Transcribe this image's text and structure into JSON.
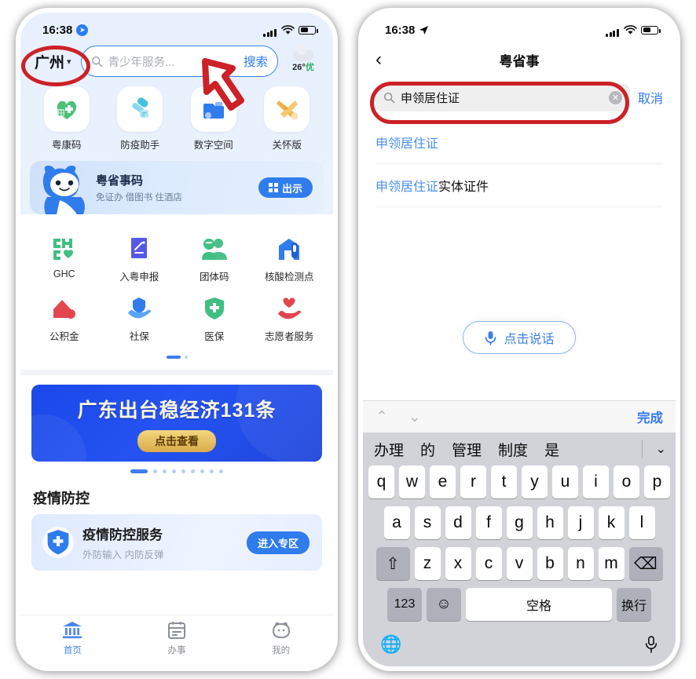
{
  "colors": {
    "accent_blue": "#2f7ced",
    "link_blue": "#4a90f0",
    "highlight_red": "#cc2127",
    "banner_blue": "#1f46dc",
    "gold": "#d9ab4a"
  },
  "left_phone": {
    "status_bar": {
      "time": "16:38",
      "location_icon": "location-arrow-icon",
      "signal_icon": "cellular-signal-icon",
      "wifi_icon": "wifi-icon",
      "battery_icon": "battery-icon"
    },
    "header": {
      "city": "广州",
      "city_chevron": "chevron-down-icon",
      "search_icon": "search-icon",
      "search_placeholder": "青少年服务...",
      "search_button": "搜索",
      "weather_icon": "cloud-icon",
      "weather_temp": "26°",
      "weather_quality": "优"
    },
    "app_row": [
      {
        "label": "粤康码",
        "icon": "heart-health-code-icon"
      },
      {
        "label": "防疫助手",
        "icon": "epidemic-assistant-icon"
      },
      {
        "label": "数字空间",
        "icon": "digital-space-folder-icon"
      },
      {
        "label": "关怀版",
        "icon": "care-version-ribbon-icon"
      }
    ],
    "yss_banner": {
      "mascot_icon": "mascot-icon",
      "title": "粤省事码",
      "subtitle": "免证办 借图书 住酒店",
      "button": "出示",
      "button_icon": "qr-code-icon"
    },
    "service_grid": {
      "rows": [
        [
          {
            "label": "GHC",
            "icon": "ghc-icon"
          },
          {
            "label": "入粤申报",
            "icon": "declaration-pen-icon"
          },
          {
            "label": "团体码",
            "icon": "group-code-icon"
          },
          {
            "label": "核酸检测点",
            "icon": "testing-site-icon"
          }
        ],
        [
          {
            "label": "公积金",
            "icon": "housing-fund-icon"
          },
          {
            "label": "社保",
            "icon": "social-security-icon"
          },
          {
            "label": "医保",
            "icon": "medical-insurance-shield-icon"
          },
          {
            "label": "志愿者服务",
            "icon": "volunteer-heart-hand-icon"
          }
        ]
      ],
      "page_count": 2,
      "active_page": 1
    },
    "promo": {
      "title": "广东出台稳经济131条",
      "button": "点击查看",
      "page_count": 9,
      "active_page": 1
    },
    "section": {
      "title": "疫情防控",
      "card_icon": "shield-plus-icon",
      "card_title": "疫情防控服务",
      "card_subtitle": "外防输入 内防反弹",
      "card_button": "进入专区"
    },
    "tabbar": [
      {
        "label": "首页",
        "icon": "home-building-icon",
        "active": true
      },
      {
        "label": "办事",
        "icon": "calendar-services-icon",
        "active": false
      },
      {
        "label": "我的",
        "icon": "profile-face-icon",
        "active": false
      }
    ]
  },
  "right_phone": {
    "status_bar": {
      "time": "16:38",
      "location_icon": "location-arrow-icon",
      "signal_icon": "cellular-signal-icon",
      "wifi_icon": "wifi-icon",
      "battery_icon": "battery-icon"
    },
    "navbar": {
      "back_icon": "chevron-left-icon",
      "title": "粤省事"
    },
    "search": {
      "search_icon": "search-icon",
      "value": "申领居住证",
      "clear_icon": "clear-circle-icon",
      "cancel": "取消"
    },
    "suggestions": [
      {
        "highlight": "申领居住证",
        "rest": ""
      },
      {
        "highlight": "申领居住证",
        "rest": "实体证件"
      }
    ],
    "voice": {
      "icon": "microphone-icon",
      "label": "点击说话"
    },
    "keyboard": {
      "toolbar": {
        "up_icon": "chevron-up-icon",
        "down_icon": "chevron-down-icon",
        "done": "完成"
      },
      "candidates": [
        "办理",
        "的",
        "管理",
        "制度",
        "是"
      ],
      "candidates_expand_icon": "chevron-down-icon",
      "row1": [
        "q",
        "w",
        "e",
        "r",
        "t",
        "y",
        "u",
        "i",
        "o",
        "p"
      ],
      "row2": [
        "a",
        "s",
        "d",
        "f",
        "g",
        "h",
        "j",
        "k",
        "l"
      ],
      "row3": [
        "z",
        "x",
        "c",
        "v",
        "b",
        "n",
        "m"
      ],
      "shift_icon": "shift-up-arrow-icon",
      "backspace_icon": "backspace-delete-icon",
      "numeric_key": "123",
      "emoji_icon": "emoji-smiley-icon",
      "space_key": "空格",
      "return_key": "换行",
      "globe_icon": "globe-language-icon",
      "dictation_icon": "microphone-icon"
    }
  },
  "annotations": {
    "city_highlight": "red-oval-highlight",
    "search_field_highlight": "red-oval-highlight",
    "cursor": "mouse-cursor-arrow"
  }
}
